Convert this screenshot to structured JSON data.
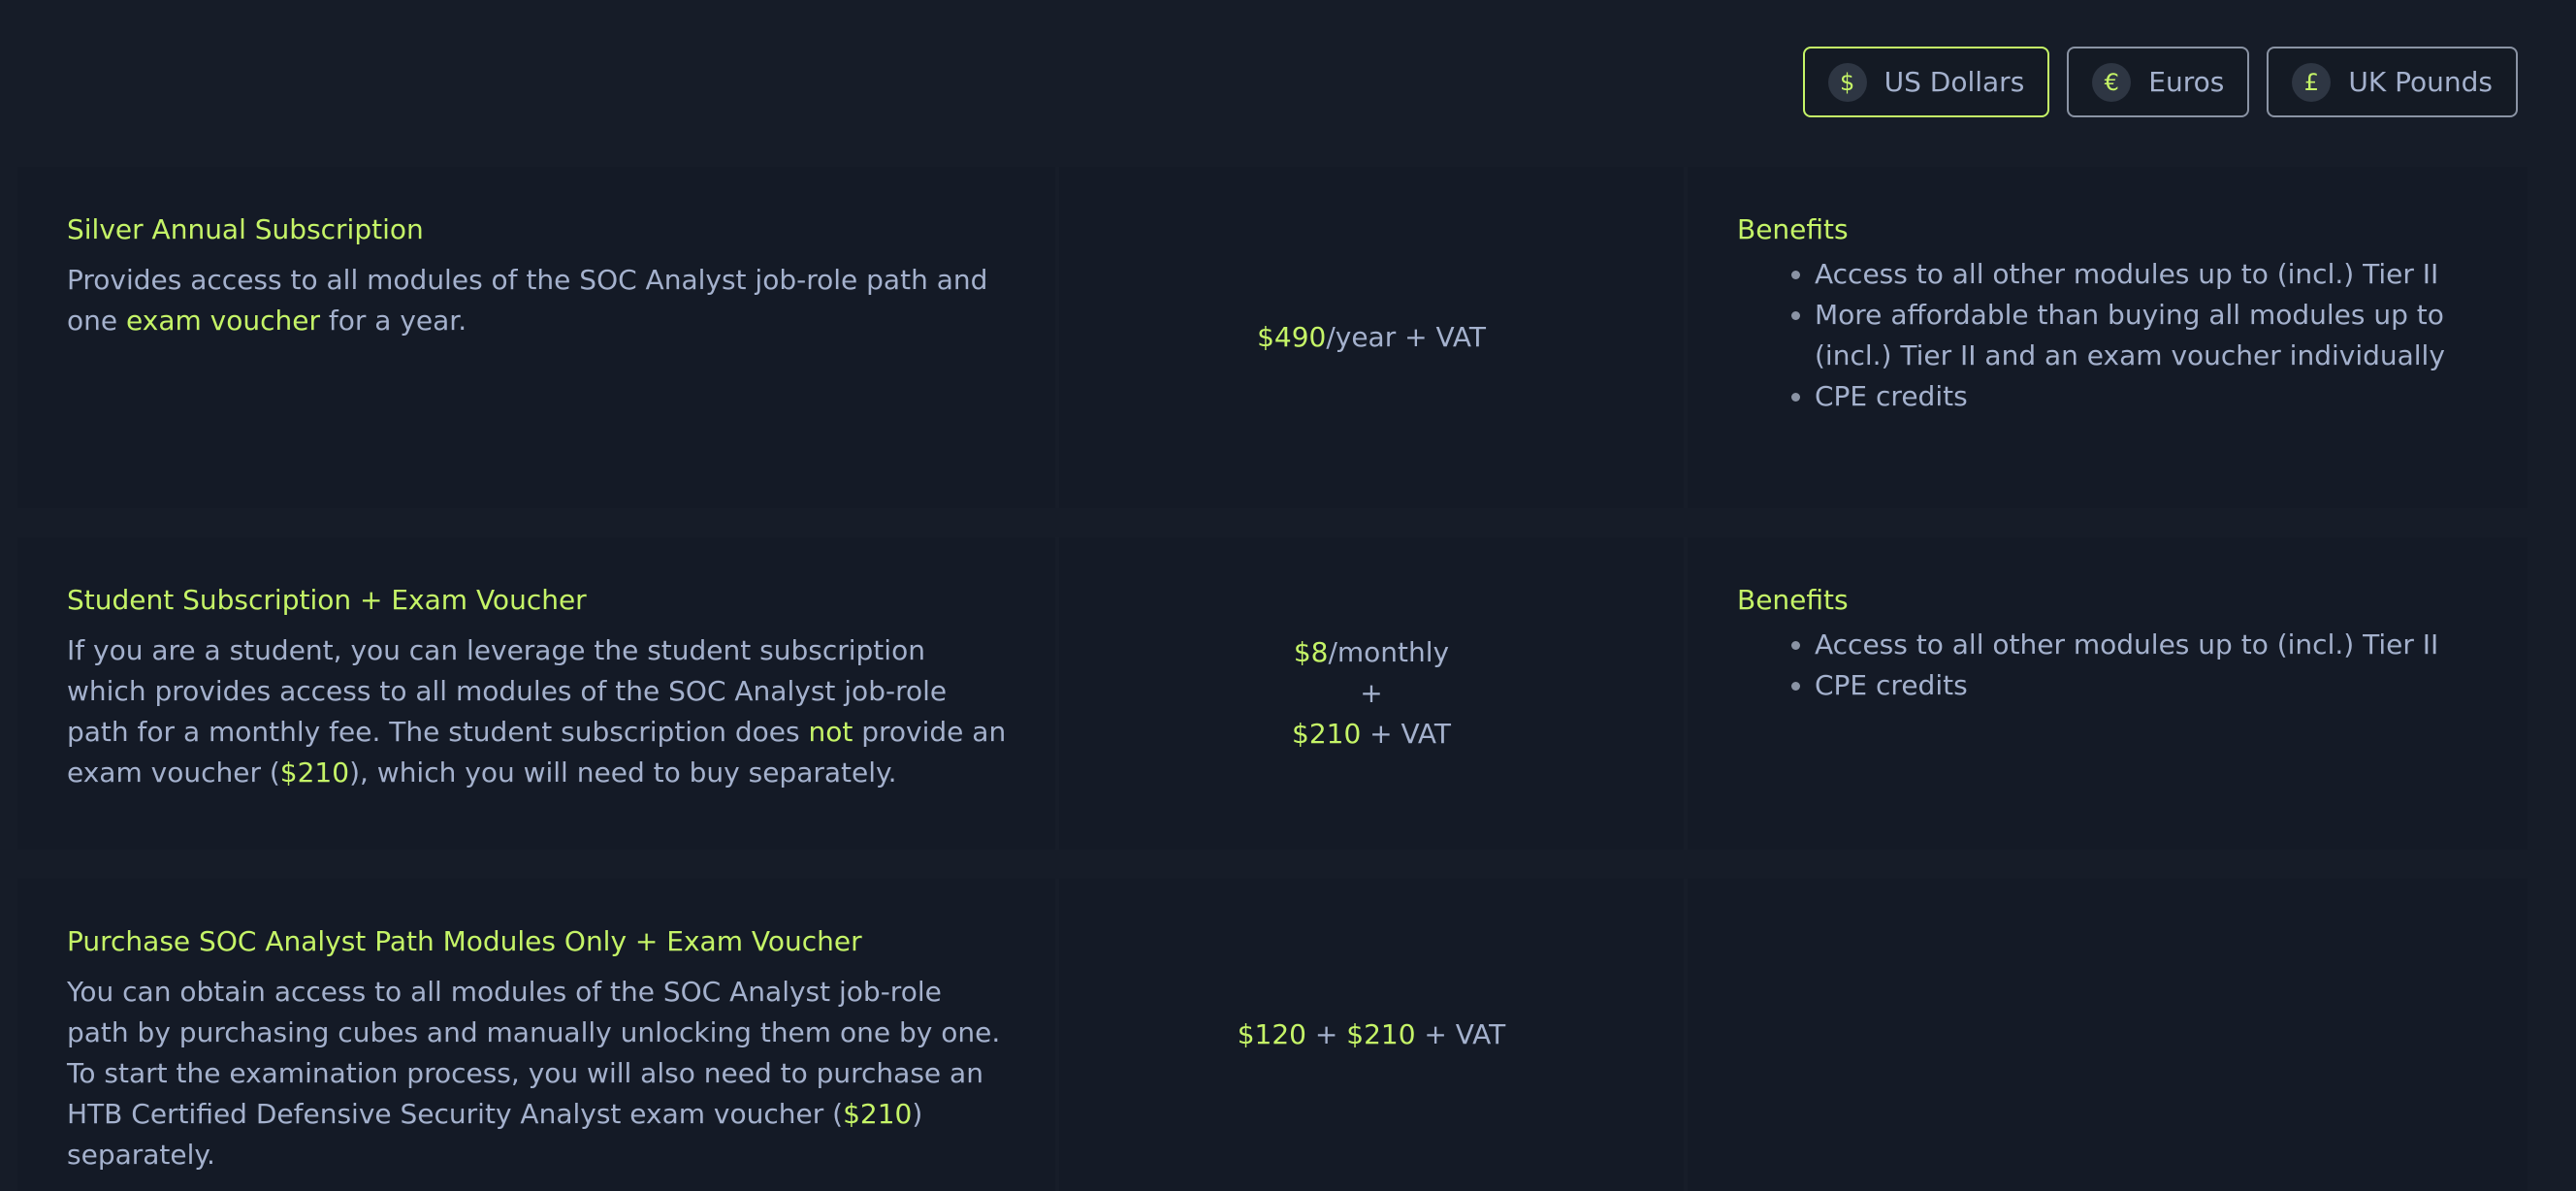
{
  "currency": {
    "options": [
      {
        "symbol": "$",
        "label": "US Dollars",
        "active": true
      },
      {
        "symbol": "€",
        "label": "Euros",
        "active": false
      },
      {
        "symbol": "£",
        "label": "UK Pounds",
        "active": false
      }
    ]
  },
  "plans": [
    {
      "title": "Silver Annual Subscription",
      "desc": {
        "p1": "Provides access to all modules of the SOC Analyst job-role path and one ",
        "hl1": "exam voucher",
        "p2": " for a year."
      },
      "price": {
        "amount": "$490",
        "suffix": "/year + VAT"
      },
      "benefits_heading": "Benefits",
      "benefits": [
        "Access to all other modules up to (incl.) Tier II",
        "More affordable than buying all modules up to (incl.) Tier II and an exam voucher individually",
        "CPE credits"
      ]
    },
    {
      "title": "Student Subscription + Exam Voucher",
      "desc": {
        "p1": "If you are a student, you can leverage the student subscription which provides access to all modules of the SOC Analyst job-role path for a monthly fee. The student subscription does ",
        "hl1": "not",
        "p2": " provide an exam voucher (",
        "hl2": "$210",
        "p3": "), which you will need to buy separately."
      },
      "price": {
        "amount1": "$8",
        "suffix1": "/monthly",
        "plus": "+",
        "amount2": "$210",
        "suffix2": " + VAT"
      },
      "benefits_heading": "Benefits",
      "benefits": [
        "Access to all other modules up to (incl.) Tier II",
        "CPE credits"
      ]
    },
    {
      "title": "Purchase SOC Analyst Path Modules Only + Exam Voucher",
      "desc": {
        "p1": "You can obtain access to all modules of the SOC Analyst job-role path by purchasing cubes and manually unlocking them one by one. To start the examination process, you will also need to purchase an HTB Certified Defensive Security Analyst exam voucher (",
        "hl1": "$210",
        "p2": ") separately."
      },
      "price": {
        "amount1": "$120",
        "sep1": " + ",
        "amount2": "$210",
        "suffix": " + VAT"
      }
    }
  ]
}
